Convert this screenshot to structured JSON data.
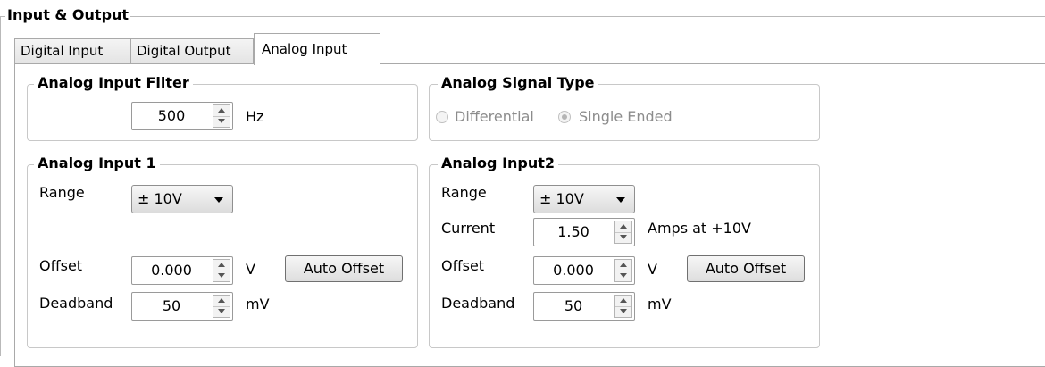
{
  "group_title": "Input & Output",
  "tabs": [
    {
      "label": "Digital Input"
    },
    {
      "label": "Digital Output"
    },
    {
      "label": "Analog Input"
    }
  ],
  "filter": {
    "title": "Analog Input Filter",
    "value": "500",
    "unit": "Hz"
  },
  "signal_type": {
    "title": "Analog Signal Type",
    "options": [
      {
        "label": "Differential",
        "selected": false
      },
      {
        "label": "Single Ended",
        "selected": true
      }
    ]
  },
  "input1": {
    "title": "Analog Input 1",
    "range_label": "Range",
    "range_value": "± 10V",
    "offset_label": "Offset",
    "offset_value": "0.000",
    "offset_unit": "V",
    "auto_offset_label": "Auto Offset",
    "deadband_label": "Deadband",
    "deadband_value": "50",
    "deadband_unit": "mV"
  },
  "input2": {
    "title": "Analog Input2",
    "range_label": "Range",
    "range_value": "± 10V",
    "current_label": "Current",
    "current_value": "1.50",
    "current_unit": "Amps at +10V",
    "offset_label": "Offset",
    "offset_value": "0.000",
    "offset_unit": "V",
    "auto_offset_label": "Auto Offset",
    "deadband_label": "Deadband",
    "deadband_value": "50",
    "deadband_unit": "mV"
  }
}
